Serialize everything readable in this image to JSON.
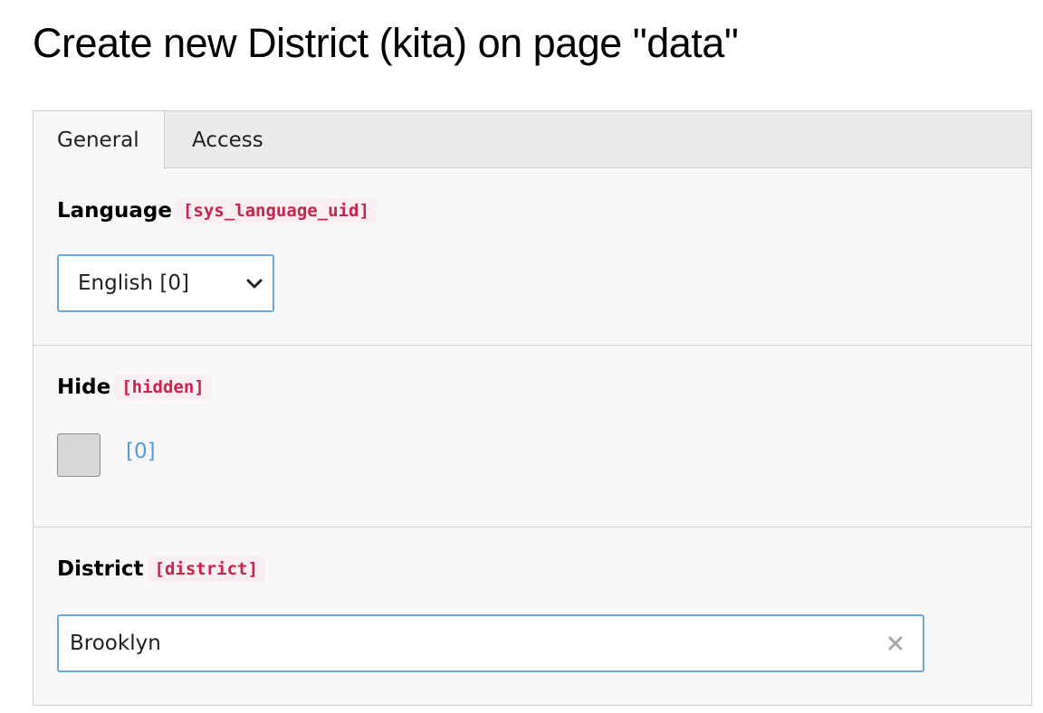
{
  "page": {
    "title": "Create new District (kita) on page \"data\""
  },
  "tabs": [
    {
      "label": "General",
      "active": true
    },
    {
      "label": "Access",
      "active": false
    }
  ],
  "fields": {
    "language": {
      "label": "Language",
      "code": "[sys_language_uid]",
      "selected": "English [0]"
    },
    "hide": {
      "label": "Hide",
      "code": "[hidden]",
      "value": "[0]",
      "checked": false
    },
    "district": {
      "label": "District",
      "code": "[district]",
      "value": "Brooklyn"
    }
  },
  "icons": {
    "select_chevron": "chevron-down-icon",
    "clear": "close-icon"
  },
  "colors": {
    "code_text": "#c7254e",
    "code_bg": "#f9eef1",
    "focus_border": "#6ea7d9",
    "value_link": "#5a9bd8"
  }
}
